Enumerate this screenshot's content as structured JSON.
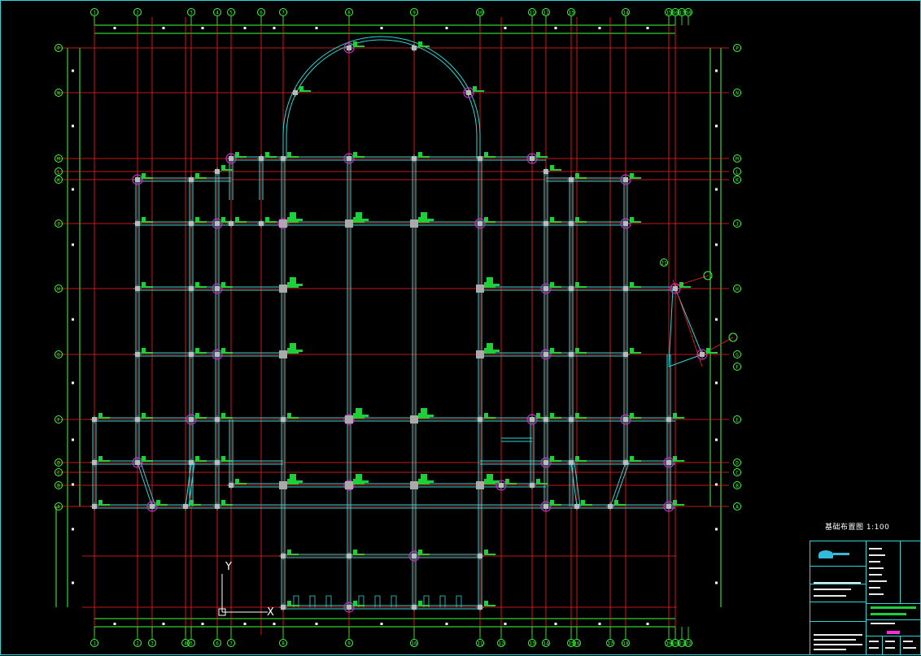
{
  "drawing": {
    "title": "基础布置图 1:100"
  },
  "axes": {
    "top": [
      "1",
      "2",
      "3",
      "4",
      "5",
      "6",
      "7",
      "8",
      "9",
      "10",
      "11",
      "12",
      "13",
      "14",
      "15",
      "16",
      "17",
      "18"
    ],
    "bottom": [
      "1",
      "2",
      "3",
      "4",
      "5",
      "6",
      "7",
      "8",
      "9",
      "10",
      "11",
      "12",
      "13",
      "14",
      "15",
      "16",
      "17",
      "18",
      "19",
      "20",
      "21",
      "22"
    ],
    "left": [
      "P",
      "N",
      "M",
      "L",
      "K",
      "J",
      "H",
      "G",
      "F",
      "D",
      "C",
      "B",
      "A"
    ],
    "right": [
      "P",
      "N",
      "M",
      "L",
      "K",
      "J",
      "H",
      "G",
      "F",
      "E",
      "D",
      "C",
      "B",
      "A"
    ],
    "special_bubble": "21"
  },
  "ucs": {
    "x_label": "X",
    "y_label": "Y"
  },
  "colors": {
    "background": "#000000",
    "axis_red": "#ff2020",
    "wall_cyan": "#2fd6d6",
    "tag_green": "#1fcf3a",
    "column_magenta": "#d02bd0",
    "dim_green": "#3cff3c",
    "highlight_magenta": "#ff2bd6"
  },
  "icons": {
    "ucs": "ucs-axis-icon",
    "logo": "company-logo-icon"
  }
}
